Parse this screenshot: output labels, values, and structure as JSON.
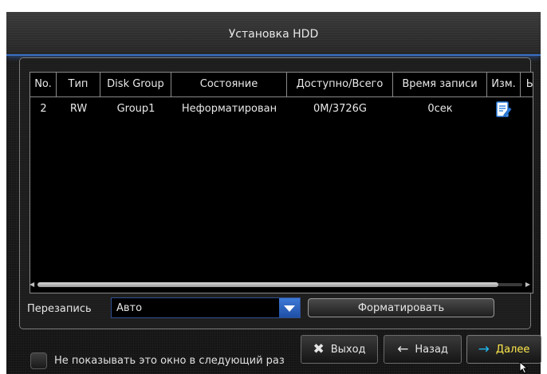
{
  "window": {
    "title": "Установка HDD"
  },
  "table": {
    "columns": [
      "No.",
      "Тип",
      "Disk Group",
      "Состояние",
      "Доступно/Всего",
      "Время записи",
      "Изм.",
      "Ы"
    ],
    "rows": [
      {
        "no": "2",
        "type": "RW",
        "group": "Group1",
        "state": "Неформатирован",
        "avail": "0M/3726G",
        "rec_time": "0сек",
        "edit_icon": "edit-icon"
      }
    ]
  },
  "overwrite": {
    "label": "Перезапись",
    "value": "Авто"
  },
  "format_button": {
    "label": "Форматировать"
  },
  "dont_show": {
    "label": "Не показывать это окно в следующий раз"
  },
  "buttons": {
    "exit": "Выход",
    "back": "Назад",
    "next": "Далее"
  },
  "colors": {
    "accent": "#3b6fc4",
    "next_label": "#ffe84a",
    "next_arrow": "#21b8f0"
  }
}
